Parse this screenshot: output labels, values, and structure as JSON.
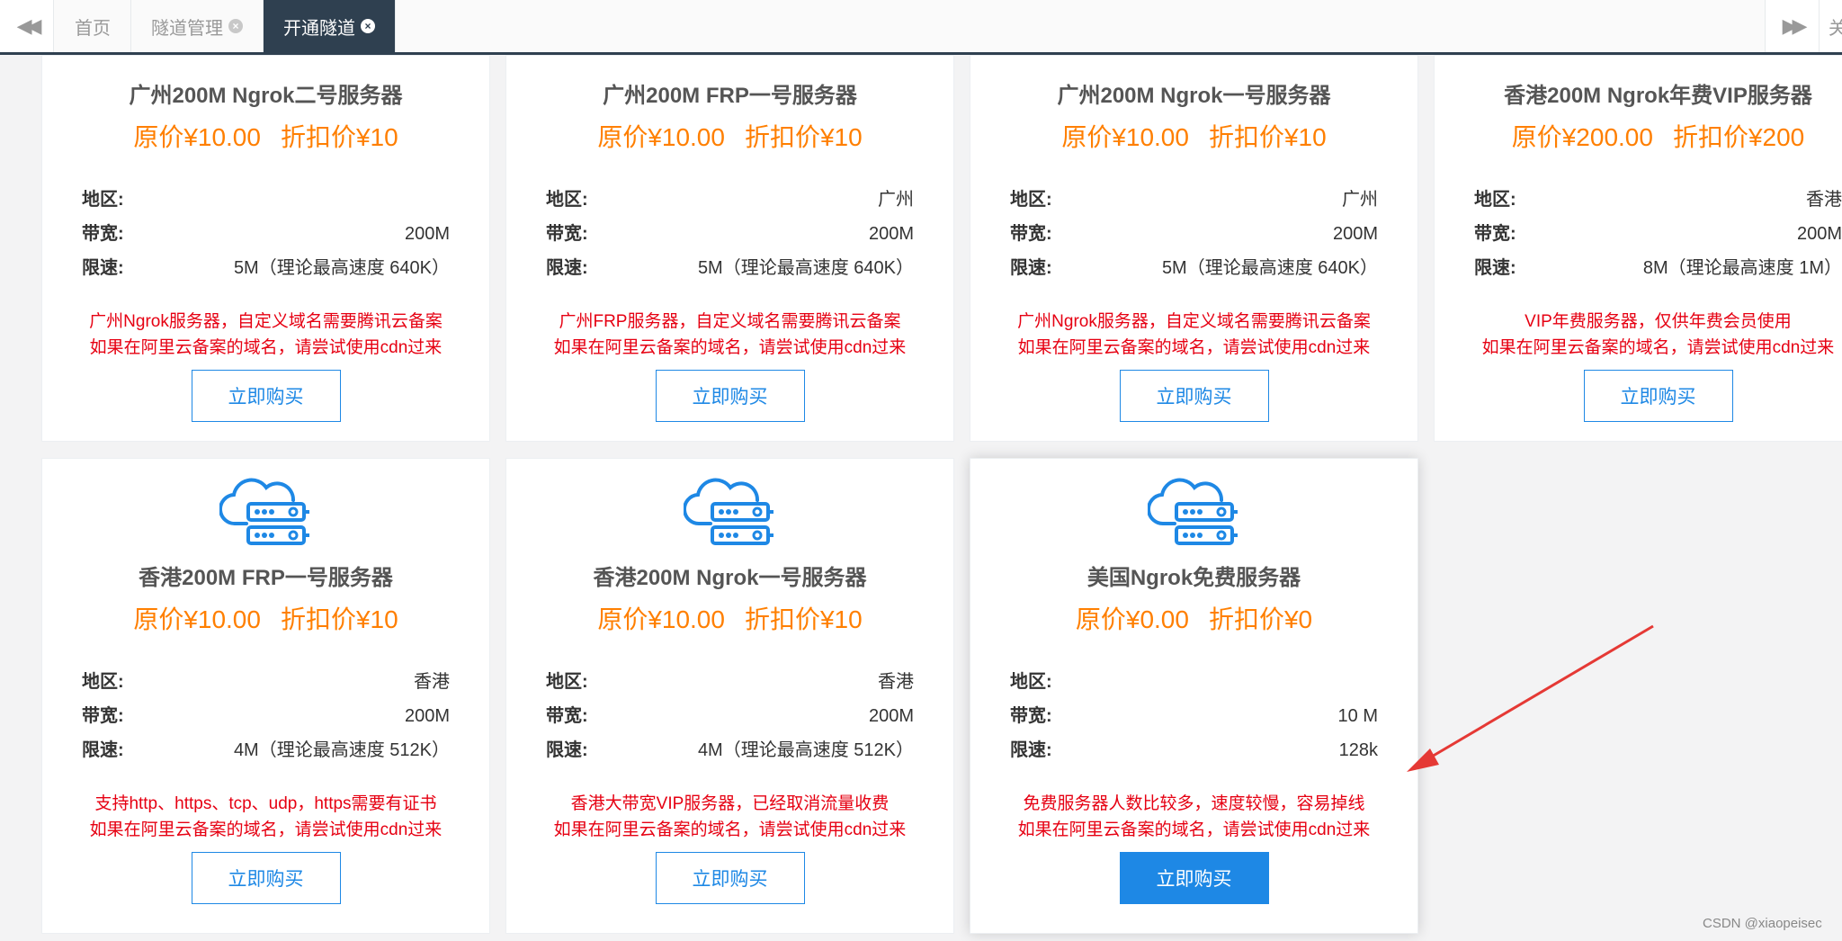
{
  "tabbar": {
    "tabs": [
      {
        "label": "首页",
        "closable": false
      },
      {
        "label": "隧道管理",
        "closable": true
      },
      {
        "label": "开通隧道",
        "closable": true,
        "active": true
      }
    ],
    "close_all_label": "关"
  },
  "spec_labels": {
    "region": "地区:",
    "bandwidth": "带宽:",
    "speed": "限速:"
  },
  "buy_label": "立即购买",
  "cards": [
    {
      "title": "广州200M Ngrok二号服务器",
      "original_price": "原价¥10.00",
      "discount_price": "折扣价¥10",
      "region": "",
      "bandwidth": "200M",
      "speed": "5M（理论最高速度 640K）",
      "note_1": "广州Ngrok服务器，自定义域名需要腾讯云备案",
      "note_2": "如果在阿里云备案的域名，请尝试使用cdn过来"
    },
    {
      "title": "广州200M FRP一号服务器",
      "original_price": "原价¥10.00",
      "discount_price": "折扣价¥10",
      "region": "广州",
      "bandwidth": "200M",
      "speed": "5M（理论最高速度 640K）",
      "note_1": "广州FRP服务器，自定义域名需要腾讯云备案",
      "note_2": "如果在阿里云备案的域名，请尝试使用cdn过来"
    },
    {
      "title": "广州200M Ngrok一号服务器",
      "original_price": "原价¥10.00",
      "discount_price": "折扣价¥10",
      "region": "广州",
      "bandwidth": "200M",
      "speed": "5M（理论最高速度 640K）",
      "note_1": "广州Ngrok服务器，自定义域名需要腾讯云备案",
      "note_2": "如果在阿里云备案的域名，请尝试使用cdn过来"
    },
    {
      "title": "香港200M Ngrok年费VIP服务器",
      "original_price": "原价¥200.00",
      "discount_price": "折扣价¥200",
      "region": "香港",
      "bandwidth": "200M",
      "speed": "8M（理论最高速度 1M）",
      "note_1": "VIP年费服务器，仅供年费会员使用",
      "note_2": "如果在阿里云备案的域名，请尝试使用cdn过来"
    },
    {
      "title": "香港200M FRP一号服务器",
      "original_price": "原价¥10.00",
      "discount_price": "折扣价¥10",
      "region": "香港",
      "bandwidth": "200M",
      "speed": "4M（理论最高速度 512K）",
      "note_1": "支持http、https、tcp、udp，https需要有证书",
      "note_2": "如果在阿里云备案的域名，请尝试使用cdn过来"
    },
    {
      "title": "香港200M Ngrok一号服务器",
      "original_price": "原价¥10.00",
      "discount_price": "折扣价¥10",
      "region": "香港",
      "bandwidth": "200M",
      "speed": "4M（理论最高速度 512K）",
      "note_1": "香港大带宽VIP服务器，已经取消流量收费",
      "note_2": "如果在阿里云备案的域名，请尝试使用cdn过来"
    },
    {
      "title": "美国Ngrok免费服务器",
      "original_price": "原价¥0.00",
      "discount_price": "折扣价¥0",
      "region": "",
      "bandwidth": "10 M",
      "speed": "128k",
      "note_1": "免费服务器人数比较多，速度较慢，容易掉线",
      "note_2": "如果在阿里云备案的域名，请尝试使用cdn过来"
    }
  ],
  "watermark": "CSDN @xiaopeisec",
  "colors": {
    "accent": "#1e88e5",
    "price": "#ff7f00",
    "note": "#e60012",
    "tab_active": "#2f4050",
    "arrow": "#e53935"
  }
}
